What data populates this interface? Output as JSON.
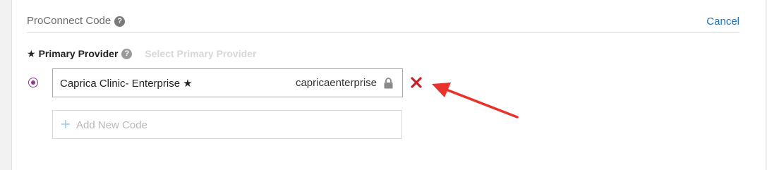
{
  "section": {
    "title": "ProConnect Code",
    "help_icon": "question-circle-icon",
    "cancel_label": "Cancel"
  },
  "primary_provider": {
    "star": "★",
    "label": "Primary Provider",
    "help_icon": "question-circle-icon",
    "select_label": "Select Primary Provider"
  },
  "codes": [
    {
      "name": "Caprica Clinic- Enterprise ★",
      "code": "caprica­enterprise",
      "selected": true,
      "lock_icon": "lock-icon",
      "remove_icon": "close-icon"
    }
  ],
  "add_code": {
    "icon": "plus-icon",
    "label": "Add New Code"
  },
  "colors": {
    "link": "#1f73b7",
    "radio": "#8e3a8a",
    "remove": "#c8202a",
    "annotation_arrow": "#e8322b"
  }
}
